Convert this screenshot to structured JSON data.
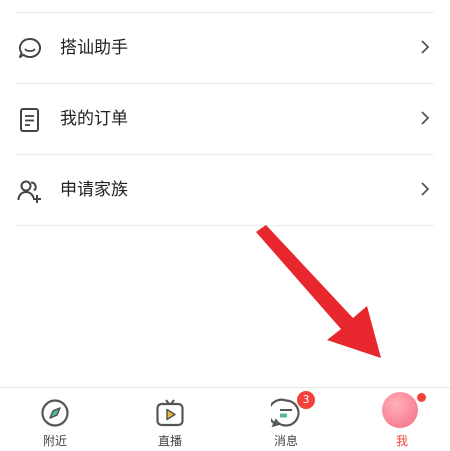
{
  "menu": {
    "items": [
      {
        "label": "搭讪助手",
        "icon": "chat-bubble-icon"
      },
      {
        "label": "我的订单",
        "icon": "document-icon"
      },
      {
        "label": "申请家族",
        "icon": "add-users-icon"
      }
    ]
  },
  "tabbar": {
    "tabs": [
      {
        "label": "附近",
        "icon": "compass-icon"
      },
      {
        "label": "直播",
        "icon": "tv-play-icon"
      },
      {
        "label": "消息",
        "icon": "message-icon",
        "badge": "3"
      },
      {
        "label": "我",
        "icon": "avatar-icon"
      }
    ]
  },
  "colors": {
    "accent": "#f2413a",
    "arrow": "#e8262d"
  }
}
